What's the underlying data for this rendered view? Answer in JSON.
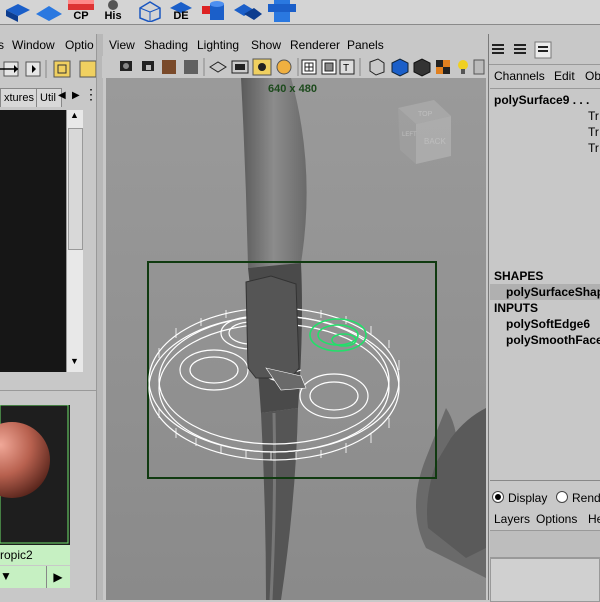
{
  "shelf": {
    "labels": [
      "CP",
      "His",
      "DE"
    ]
  },
  "left_panel": {
    "menu": [
      "Window",
      "Optio"
    ],
    "tabs": [
      "xtures",
      "Util"
    ],
    "material_label": "ropic2"
  },
  "viewport": {
    "menu": [
      "View",
      "Shading",
      "Lighting",
      "Show",
      "Renderer",
      "Panels"
    ],
    "resolution_label": "640 x 480",
    "viewcube_faces": [
      "TOP",
      "BACK",
      "LEFT"
    ]
  },
  "channel_box": {
    "menu": [
      "Channels",
      "Edit",
      "Obj"
    ],
    "object_name": "polySurface9 . . .",
    "attributes": [
      "Tr",
      "Tr",
      "Tr"
    ],
    "shapes_header": "SHAPES",
    "shape_name": "polySurfaceShap",
    "inputs_header": "INPUTS",
    "inputs": [
      "polySoftEdge6",
      "polySmoothFace"
    ]
  },
  "layer_editor": {
    "radio_display": "Display",
    "radio_render": "Rend",
    "menu": [
      "Layers",
      "Options",
      "He"
    ]
  },
  "colors": {
    "panel_bg": "#c8c8c8",
    "viewport_bg": "#8f8f8f",
    "highlight_green": "#22e06a",
    "material_label_bg": "#c6f0c2"
  }
}
